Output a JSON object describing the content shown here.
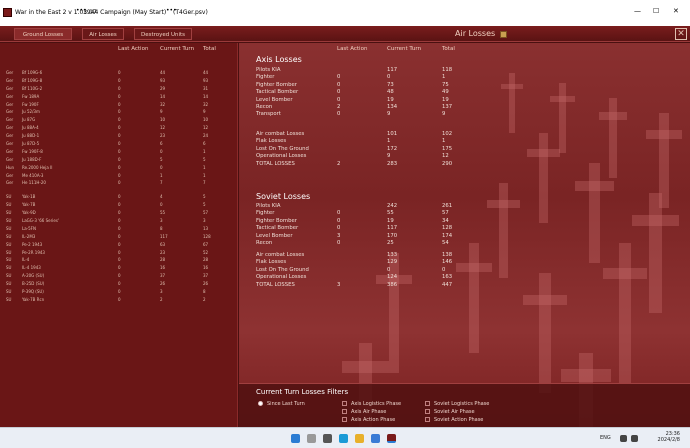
{
  "titlebar": {
    "app_title": "War in the East 2  v 1.03.07",
    "sep": "•••",
    "campaign": "1944 Campaign (May Start)",
    "save_file": "(T4Ger.psv)",
    "min": "—",
    "max": "☐",
    "close": "✕"
  },
  "tabs": {
    "ground": "Ground Losses",
    "air": "Air Losses",
    "destroyed": "Destroyed Units"
  },
  "panel": {
    "title": "Air Losses",
    "close": "✕"
  },
  "left": {
    "headers": {
      "last_action": "Last Action",
      "current_turn": "Current Turn",
      "total": "Total"
    },
    "groups": [
      {
        "rows": [
          [
            "Ger",
            "Bf 109G-6",
            "0",
            "44",
            "44"
          ],
          [
            "Ger",
            "Bf 109G-8",
            "0",
            "93",
            "93"
          ],
          [
            "Ger",
            "Bf 110G-2",
            "0",
            "29",
            "31"
          ],
          [
            "Ger",
            "Fw 189A",
            "0",
            "14",
            "14"
          ],
          [
            "Ger",
            "Fw 190F",
            "0",
            "32",
            "32"
          ],
          [
            "Ger",
            "Ju 52/3m",
            "0",
            "9",
            "9"
          ],
          [
            "Ger",
            "Ju 87G",
            "0",
            "10",
            "10"
          ],
          [
            "Ger",
            "Ju 88A-4",
            "0",
            "12",
            "12"
          ],
          [
            "Ger",
            "Ju 88D-1",
            "0",
            "23",
            "24"
          ],
          [
            "Ger",
            "Ju 87D-5",
            "0",
            "6",
            "6"
          ],
          [
            "Ger",
            "Fw 190F-8",
            "0",
            "0",
            "1"
          ],
          [
            "Ger",
            "Ju 188D-F",
            "0",
            "5",
            "5"
          ],
          [
            "Hun",
            "Re.2000 Heja II",
            "0",
            "0",
            "1"
          ],
          [
            "Ger",
            "Me 410A-3",
            "0",
            "1",
            "1"
          ],
          [
            "Ger",
            "He 111H-20",
            "0",
            "7",
            "7"
          ]
        ]
      },
      {
        "rows": [
          [
            "SU",
            "Yak-1B",
            "0",
            "4",
            "5"
          ],
          [
            "SU",
            "Yak-7B",
            "0",
            "0",
            "5"
          ],
          [
            "SU",
            "Yak-9D",
            "0",
            "55",
            "57"
          ],
          [
            "SU",
            "LaGG-3 '66 Series'",
            "0",
            "3",
            "3"
          ],
          [
            "SU",
            "La-5FN",
            "0",
            "8",
            "13"
          ],
          [
            "SU",
            "IL-2M3",
            "0",
            "117",
            "128"
          ],
          [
            "SU",
            "Pe-2 1943",
            "0",
            "63",
            "67"
          ],
          [
            "SU",
            "Pe-2R 1943",
            "0",
            "23",
            "52"
          ],
          [
            "SU",
            "IL-4",
            "0",
            "28",
            "28"
          ],
          [
            "SU",
            "IL-4 1943",
            "0",
            "16",
            "16"
          ],
          [
            "SU",
            "A-20G (SU)",
            "0",
            "37",
            "37"
          ],
          [
            "SU",
            "B-25D (SU)",
            "0",
            "26",
            "26"
          ],
          [
            "SU",
            "P-39Q (SU)",
            "0",
            "3",
            "8"
          ],
          [
            "SU",
            "Yak-7B Rcn",
            "0",
            "2",
            "2"
          ]
        ]
      }
    ]
  },
  "air": {
    "headers": {
      "last_action": "Last Action",
      "current_turn": "Current Turn",
      "total": "Total"
    },
    "axis": {
      "title": "Axis Losses",
      "block1": [
        [
          "Pilots KIA",
          "",
          "117",
          "118"
        ],
        [
          "Fighter",
          "0",
          "0",
          "1"
        ],
        [
          "Fighter Bomber",
          "0",
          "73",
          "75"
        ],
        [
          "Tactical Bomber",
          "0",
          "48",
          "49"
        ],
        [
          "Level Bomber",
          "0",
          "19",
          "19"
        ],
        [
          "Recon",
          "2",
          "134",
          "137"
        ],
        [
          "Transport",
          "0",
          "9",
          "9"
        ]
      ],
      "block2": [
        [
          "Air combat Losses",
          "",
          "101",
          "102"
        ],
        [
          "Flak Losses",
          "",
          "1",
          "1"
        ],
        [
          "Lost On The Ground",
          "",
          "172",
          "175"
        ],
        [
          "Operational Losses",
          "",
          "9",
          "12"
        ],
        [
          "TOTAL LOSSES",
          "2",
          "283",
          "290"
        ]
      ]
    },
    "soviet": {
      "title": "Soviet Losses",
      "block1": [
        [
          "Pilots KIA",
          "",
          "242",
          "261"
        ],
        [
          "Fighter",
          "0",
          "55",
          "57"
        ],
        [
          "Fighter Bomber",
          "0",
          "19",
          "34"
        ],
        [
          "Tactical Bomber",
          "0",
          "117",
          "128"
        ],
        [
          "Level Bomber",
          "3",
          "170",
          "174"
        ],
        [
          "Recon",
          "0",
          "25",
          "54"
        ]
      ],
      "block2": [
        [
          "Air combat Losses",
          "",
          "133",
          "138"
        ],
        [
          "Flak Losses",
          "",
          "129",
          "146"
        ],
        [
          "Lost On The Ground",
          "",
          "0",
          "0"
        ],
        [
          "Operational Losses",
          "",
          "124",
          "163"
        ],
        [
          "TOTAL LOSSES",
          "3",
          "386",
          "447"
        ]
      ]
    }
  },
  "filters": {
    "title": "Current Turn Losses Filters",
    "since_last_turn": "Since Last Turn",
    "options": [
      "Axis Logistics Phase",
      "Axis Air Phase",
      "Axis Action Phase",
      "Soviet Logistics Phase",
      "Soviet Air Phase",
      "Soviet Action Phase"
    ]
  },
  "taskbar": {
    "lang": "ENG",
    "time": "23:36",
    "date": "2024/2/8"
  }
}
